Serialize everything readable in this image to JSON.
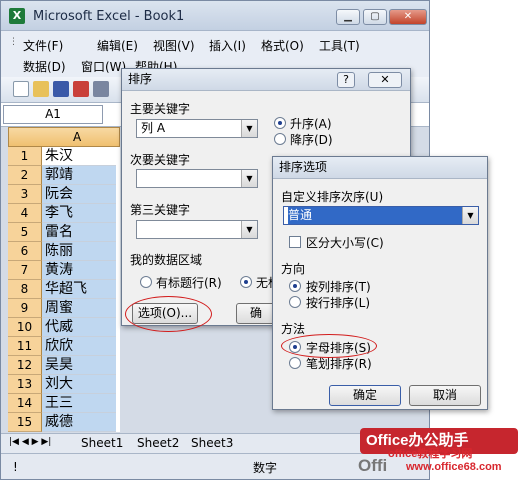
{
  "window": {
    "title": "Microsoft Excel - Book1"
  },
  "menus": {
    "row1": [
      "文件(F)",
      "编辑(E)",
      "视图(V)",
      "插入(I)",
      "格式(O)",
      "工具(T)"
    ],
    "row2": [
      "数据(D)",
      "窗口(W)",
      "帮助(H)"
    ]
  },
  "formula": {
    "namebox": "A1"
  },
  "sheet": {
    "col_header": "A",
    "row_numbers": [
      "1",
      "2",
      "3",
      "4",
      "5",
      "6",
      "7",
      "8",
      "9",
      "10",
      "11",
      "12",
      "13",
      "14",
      "15"
    ],
    "cells": [
      "朱汉",
      "郭靖",
      "阮会",
      "李飞",
      "雷名",
      "陈丽",
      "黄涛",
      "华超飞",
      "周蜜",
      "代威",
      "欣欣",
      "吴昊",
      "刘大",
      "王三",
      "威德"
    ]
  },
  "sheet_tabs": [
    "Sheet1",
    "Sheet2",
    "Sheet3"
  ],
  "status": {
    "mode": "数字",
    "ready_mark": "!"
  },
  "sort_dialog": {
    "title": "排序",
    "primary_label": "主要关键字",
    "primary_value": "列 A",
    "ascending": "升序(A)",
    "descending": "降序(D)",
    "secondary_label": "次要关键字",
    "tertiary_label": "第三关键字",
    "range_label": "我的数据区域",
    "has_header": "有标题行(R)",
    "no_header": "无标",
    "options_button": "选项(O)...",
    "ok_partial": "确"
  },
  "options_dialog": {
    "title": "排序选项",
    "custom_order_label": "自定义排序次序(U)",
    "custom_order_value": "普通",
    "case_sensitive": "区分大小写(C)",
    "direction_label": "方向",
    "by_column": "按列排序(T)",
    "by_row": "按行排序(L)",
    "method_label": "方法",
    "alphabetical": "字母排序(S)",
    "stroke": "笔划排序(R)",
    "ok": "确定",
    "cancel": "取消"
  },
  "watermark": {
    "brand": "Office办公助手",
    "url": "www.office68.com",
    "brand2": "Offi",
    "site": "office教程学习网"
  }
}
